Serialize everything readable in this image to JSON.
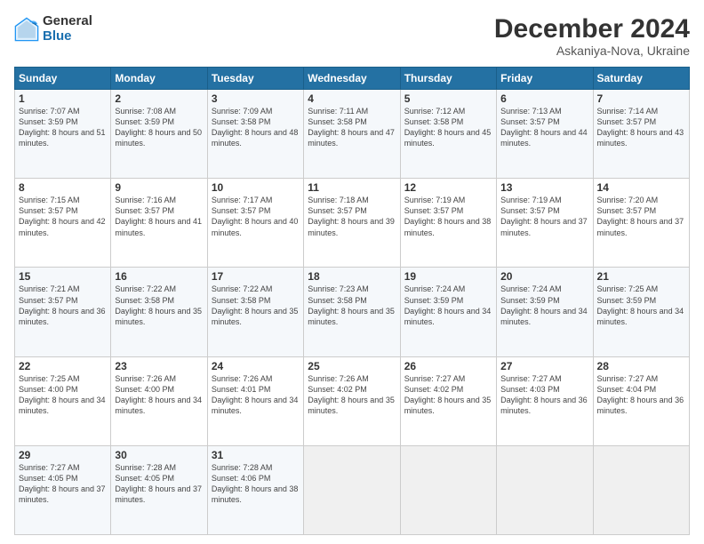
{
  "header": {
    "logo_general": "General",
    "logo_blue": "Blue",
    "month_title": "December 2024",
    "subtitle": "Askaniya-Nova, Ukraine"
  },
  "weekdays": [
    "Sunday",
    "Monday",
    "Tuesday",
    "Wednesday",
    "Thursday",
    "Friday",
    "Saturday"
  ],
  "weeks": [
    [
      {
        "day": "1",
        "sunrise": "Sunrise: 7:07 AM",
        "sunset": "Sunset: 3:59 PM",
        "daylight": "Daylight: 8 hours and 51 minutes."
      },
      {
        "day": "2",
        "sunrise": "Sunrise: 7:08 AM",
        "sunset": "Sunset: 3:59 PM",
        "daylight": "Daylight: 8 hours and 50 minutes."
      },
      {
        "day": "3",
        "sunrise": "Sunrise: 7:09 AM",
        "sunset": "Sunset: 3:58 PM",
        "daylight": "Daylight: 8 hours and 48 minutes."
      },
      {
        "day": "4",
        "sunrise": "Sunrise: 7:11 AM",
        "sunset": "Sunset: 3:58 PM",
        "daylight": "Daylight: 8 hours and 47 minutes."
      },
      {
        "day": "5",
        "sunrise": "Sunrise: 7:12 AM",
        "sunset": "Sunset: 3:58 PM",
        "daylight": "Daylight: 8 hours and 45 minutes."
      },
      {
        "day": "6",
        "sunrise": "Sunrise: 7:13 AM",
        "sunset": "Sunset: 3:57 PM",
        "daylight": "Daylight: 8 hours and 44 minutes."
      },
      {
        "day": "7",
        "sunrise": "Sunrise: 7:14 AM",
        "sunset": "Sunset: 3:57 PM",
        "daylight": "Daylight: 8 hours and 43 minutes."
      }
    ],
    [
      {
        "day": "8",
        "sunrise": "Sunrise: 7:15 AM",
        "sunset": "Sunset: 3:57 PM",
        "daylight": "Daylight: 8 hours and 42 minutes."
      },
      {
        "day": "9",
        "sunrise": "Sunrise: 7:16 AM",
        "sunset": "Sunset: 3:57 PM",
        "daylight": "Daylight: 8 hours and 41 minutes."
      },
      {
        "day": "10",
        "sunrise": "Sunrise: 7:17 AM",
        "sunset": "Sunset: 3:57 PM",
        "daylight": "Daylight: 8 hours and 40 minutes."
      },
      {
        "day": "11",
        "sunrise": "Sunrise: 7:18 AM",
        "sunset": "Sunset: 3:57 PM",
        "daylight": "Daylight: 8 hours and 39 minutes."
      },
      {
        "day": "12",
        "sunrise": "Sunrise: 7:19 AM",
        "sunset": "Sunset: 3:57 PM",
        "daylight": "Daylight: 8 hours and 38 minutes."
      },
      {
        "day": "13",
        "sunrise": "Sunrise: 7:19 AM",
        "sunset": "Sunset: 3:57 PM",
        "daylight": "Daylight: 8 hours and 37 minutes."
      },
      {
        "day": "14",
        "sunrise": "Sunrise: 7:20 AM",
        "sunset": "Sunset: 3:57 PM",
        "daylight": "Daylight: 8 hours and 37 minutes."
      }
    ],
    [
      {
        "day": "15",
        "sunrise": "Sunrise: 7:21 AM",
        "sunset": "Sunset: 3:57 PM",
        "daylight": "Daylight: 8 hours and 36 minutes."
      },
      {
        "day": "16",
        "sunrise": "Sunrise: 7:22 AM",
        "sunset": "Sunset: 3:58 PM",
        "daylight": "Daylight: 8 hours and 35 minutes."
      },
      {
        "day": "17",
        "sunrise": "Sunrise: 7:22 AM",
        "sunset": "Sunset: 3:58 PM",
        "daylight": "Daylight: 8 hours and 35 minutes."
      },
      {
        "day": "18",
        "sunrise": "Sunrise: 7:23 AM",
        "sunset": "Sunset: 3:58 PM",
        "daylight": "Daylight: 8 hours and 35 minutes."
      },
      {
        "day": "19",
        "sunrise": "Sunrise: 7:24 AM",
        "sunset": "Sunset: 3:59 PM",
        "daylight": "Daylight: 8 hours and 34 minutes."
      },
      {
        "day": "20",
        "sunrise": "Sunrise: 7:24 AM",
        "sunset": "Sunset: 3:59 PM",
        "daylight": "Daylight: 8 hours and 34 minutes."
      },
      {
        "day": "21",
        "sunrise": "Sunrise: 7:25 AM",
        "sunset": "Sunset: 3:59 PM",
        "daylight": "Daylight: 8 hours and 34 minutes."
      }
    ],
    [
      {
        "day": "22",
        "sunrise": "Sunrise: 7:25 AM",
        "sunset": "Sunset: 4:00 PM",
        "daylight": "Daylight: 8 hours and 34 minutes."
      },
      {
        "day": "23",
        "sunrise": "Sunrise: 7:26 AM",
        "sunset": "Sunset: 4:00 PM",
        "daylight": "Daylight: 8 hours and 34 minutes."
      },
      {
        "day": "24",
        "sunrise": "Sunrise: 7:26 AM",
        "sunset": "Sunset: 4:01 PM",
        "daylight": "Daylight: 8 hours and 34 minutes."
      },
      {
        "day": "25",
        "sunrise": "Sunrise: 7:26 AM",
        "sunset": "Sunset: 4:02 PM",
        "daylight": "Daylight: 8 hours and 35 minutes."
      },
      {
        "day": "26",
        "sunrise": "Sunrise: 7:27 AM",
        "sunset": "Sunset: 4:02 PM",
        "daylight": "Daylight: 8 hours and 35 minutes."
      },
      {
        "day": "27",
        "sunrise": "Sunrise: 7:27 AM",
        "sunset": "Sunset: 4:03 PM",
        "daylight": "Daylight: 8 hours and 36 minutes."
      },
      {
        "day": "28",
        "sunrise": "Sunrise: 7:27 AM",
        "sunset": "Sunset: 4:04 PM",
        "daylight": "Daylight: 8 hours and 36 minutes."
      }
    ],
    [
      {
        "day": "29",
        "sunrise": "Sunrise: 7:27 AM",
        "sunset": "Sunset: 4:05 PM",
        "daylight": "Daylight: 8 hours and 37 minutes."
      },
      {
        "day": "30",
        "sunrise": "Sunrise: 7:28 AM",
        "sunset": "Sunset: 4:05 PM",
        "daylight": "Daylight: 8 hours and 37 minutes."
      },
      {
        "day": "31",
        "sunrise": "Sunrise: 7:28 AM",
        "sunset": "Sunset: 4:06 PM",
        "daylight": "Daylight: 8 hours and 38 minutes."
      },
      null,
      null,
      null,
      null
    ]
  ]
}
